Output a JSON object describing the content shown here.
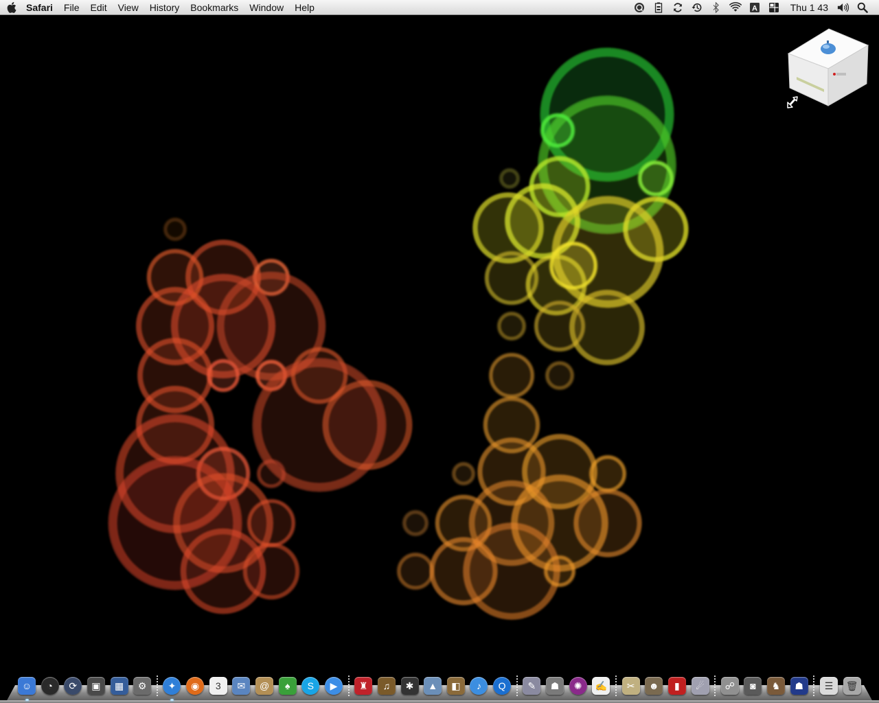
{
  "menubar": {
    "app_name": "Safari",
    "menus": [
      "File",
      "Edit",
      "View",
      "History",
      "Bookmarks",
      "Window",
      "Help"
    ],
    "status_icons": [
      "quicksilver-icon",
      "battery-monitor-icon",
      "sync-icon",
      "time-machine-icon",
      "bluetooth-icon",
      "wifi-icon",
      "input-menu-icon",
      "spaces-icon"
    ],
    "clock": "Thu 1 43",
    "volume_icon": "volume-icon",
    "spotlight_icon": "spotlight-icon"
  },
  "desktop": {
    "wallpaper": "bokeh-circles",
    "items": [
      {
        "icon": "installer-box-icon",
        "alias": true
      }
    ]
  },
  "dock": {
    "icons": [
      {
        "name": "finder-icon",
        "color": "#3b79d6",
        "glyph": "☺",
        "running": true
      },
      {
        "name": "dashboard-icon",
        "color": "#2a2a2a",
        "glyph": "◔",
        "round": true
      },
      {
        "name": "time-machine-icon",
        "color": "#3a4a6a",
        "glyph": "⟳",
        "round": true
      },
      {
        "name": "photo-booth-icon",
        "color": "#4a4a4a",
        "glyph": "▣"
      },
      {
        "name": "spaces-icon",
        "color": "#355d9a",
        "glyph": "▦"
      },
      {
        "name": "system-preferences-icon",
        "color": "#6b6b6b",
        "glyph": "⚙"
      },
      {
        "sep": true
      },
      {
        "name": "safari-icon",
        "color": "#2f7fd8",
        "glyph": "✦",
        "round": true,
        "running": true
      },
      {
        "name": "firefox-icon",
        "color": "#e06b1a",
        "glyph": "◉",
        "round": true
      },
      {
        "name": "ical-icon",
        "color": "#f0f0f0",
        "glyph": "3",
        "dark": true
      },
      {
        "name": "mail-icon",
        "color": "#5a85c0",
        "glyph": "✉"
      },
      {
        "name": "address-book-icon",
        "color": "#b38f55",
        "glyph": "@"
      },
      {
        "name": "car-app-icon",
        "color": "#3aa03a",
        "glyph": "♠"
      },
      {
        "name": "skype-icon",
        "color": "#19a5e6",
        "glyph": "S",
        "round": true
      },
      {
        "name": "ichat-icon",
        "color": "#3d8ee6",
        "glyph": "▶",
        "round": true
      },
      {
        "sep": true
      },
      {
        "name": "front-row-icon",
        "color": "#c0222a",
        "glyph": "♜"
      },
      {
        "name": "garageband-icon",
        "color": "#7a5a2a",
        "glyph": "♫"
      },
      {
        "name": "imovie-icon",
        "color": "#333333",
        "glyph": "✱"
      },
      {
        "name": "iphoto-icon",
        "color": "#6b8fb8",
        "glyph": "▲"
      },
      {
        "name": "iweb-icon",
        "color": "#8a6a3a",
        "glyph": "◧"
      },
      {
        "name": "itunes-icon",
        "color": "#3c8ee0",
        "glyph": "♪",
        "round": true
      },
      {
        "name": "quicktime-icon",
        "color": "#1b6fd0",
        "glyph": "Q",
        "round": true
      },
      {
        "sep": true
      },
      {
        "name": "script-editor-icon",
        "color": "#8a8aa0",
        "glyph": "✎"
      },
      {
        "name": "automator-icon",
        "color": "#7a7a7a",
        "glyph": "☗"
      },
      {
        "name": "directory-utility-icon",
        "color": "#8a2a8a",
        "glyph": "✺",
        "round": true
      },
      {
        "name": "textedit-icon",
        "color": "#f0f0f0",
        "glyph": "✍",
        "dark": true
      },
      {
        "sep": true
      },
      {
        "name": "disk-utility-icon",
        "color": "#c0b080",
        "glyph": "✂"
      },
      {
        "name": "gimp-icon",
        "color": "#7a6a50",
        "glyph": "☻"
      },
      {
        "name": "photo-app-icon",
        "color": "#c02020",
        "glyph": "▮"
      },
      {
        "name": "preview-icon",
        "color": "#a0a0b0",
        "glyph": "☄"
      },
      {
        "sep": true
      },
      {
        "name": "utility-icon",
        "color": "#909090",
        "glyph": "☍"
      },
      {
        "name": "screenshot-icon",
        "color": "#5a5a5a",
        "glyph": "◙"
      },
      {
        "name": "chess-icon",
        "color": "#7a5a3a",
        "glyph": "♞"
      },
      {
        "name": "game-icon",
        "color": "#223a8a",
        "glyph": "☗"
      },
      {
        "sep": true
      },
      {
        "name": "documents-stack-icon",
        "color": "#dadada",
        "glyph": "☰",
        "dark": true
      },
      {
        "name": "trash-icon",
        "color": "#a8a8a8",
        "glyph": "🗑",
        "dark": true
      }
    ]
  }
}
